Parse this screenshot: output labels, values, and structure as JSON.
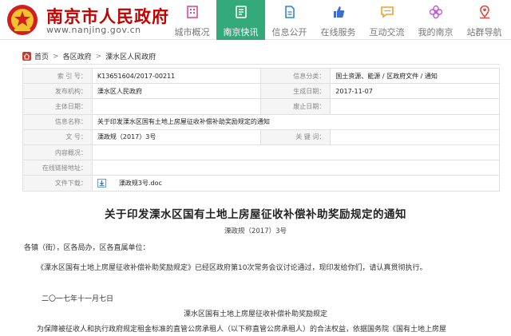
{
  "header": {
    "site_title": "南京市人民政府",
    "site_url": "www.nanjing.gov.cn",
    "nav": [
      {
        "label": "城市概况",
        "icon": "building-icon"
      },
      {
        "label": "南京快讯",
        "icon": "news-icon",
        "active": true
      },
      {
        "label": "信息公开",
        "icon": "document-icon"
      },
      {
        "label": "在线服务",
        "icon": "thumbs-up-icon"
      },
      {
        "label": "互动交流",
        "icon": "chat-icon"
      },
      {
        "label": "我的南京",
        "icon": "flower-icon"
      },
      {
        "label": "站群导航",
        "icon": "map-pin-icon"
      }
    ],
    "accent_color": "#34a97a",
    "title_color": "#c40000"
  },
  "breadcrumb": [
    "首页",
    "各区政府",
    "溧水区人民政府"
  ],
  "info": {
    "index_label": "索  引  号：",
    "index_value": "K13651604/2017-00211",
    "category_label": "信息分类：",
    "category_value": "国土资源、能源 / 区政府文件 / 通知",
    "publisher_label": "发布机构：",
    "publisher_value": "溧水区人民政府",
    "created_label": "生成日期：",
    "created_value": "2017-11-07",
    "subject_label": "主体日期：",
    "subject_value": "",
    "deadline_label": "废止日期：",
    "deadline_value": "",
    "name_label": "信息名称：",
    "name_value": "关于印发溧水区国有土地上房屋征收补偿补助奖励规定的通知",
    "docno_label": "文      号：",
    "docno_value": "溧政规（2017）3号",
    "keywords_label": "关  键  词：",
    "keywords_value": "",
    "overview_label": "内容概况：",
    "overview_value": "",
    "onlinetool_label": "在线链接地址：",
    "onlinetool_value": "",
    "download_label": "文件下载：",
    "download_file": "溧政规3号.doc"
  },
  "document": {
    "title": "关于印发溧水区国有土地上房屋征收补偿补助奖励规定的通知",
    "number": "溧政规（2017）3号",
    "salutation": "各镇（街），区各局办，区各直属单位：",
    "para1": "《溧水区国有土地上房屋征收补偿补助奖励规定》已经区政府第10次常务会议讨论通过，现印发给你们，请认真贯彻执行。",
    "date": "二〇一七年十一月七日",
    "subtitle": "溧水区国有土地上房屋征收补偿补助奖励规定",
    "para2": "为保障被征收人和执行政府规定租金标准的直管公房承租人（以下称直管公房承租人）的合法权益，依据国务院《国有土地上房屋"
  }
}
